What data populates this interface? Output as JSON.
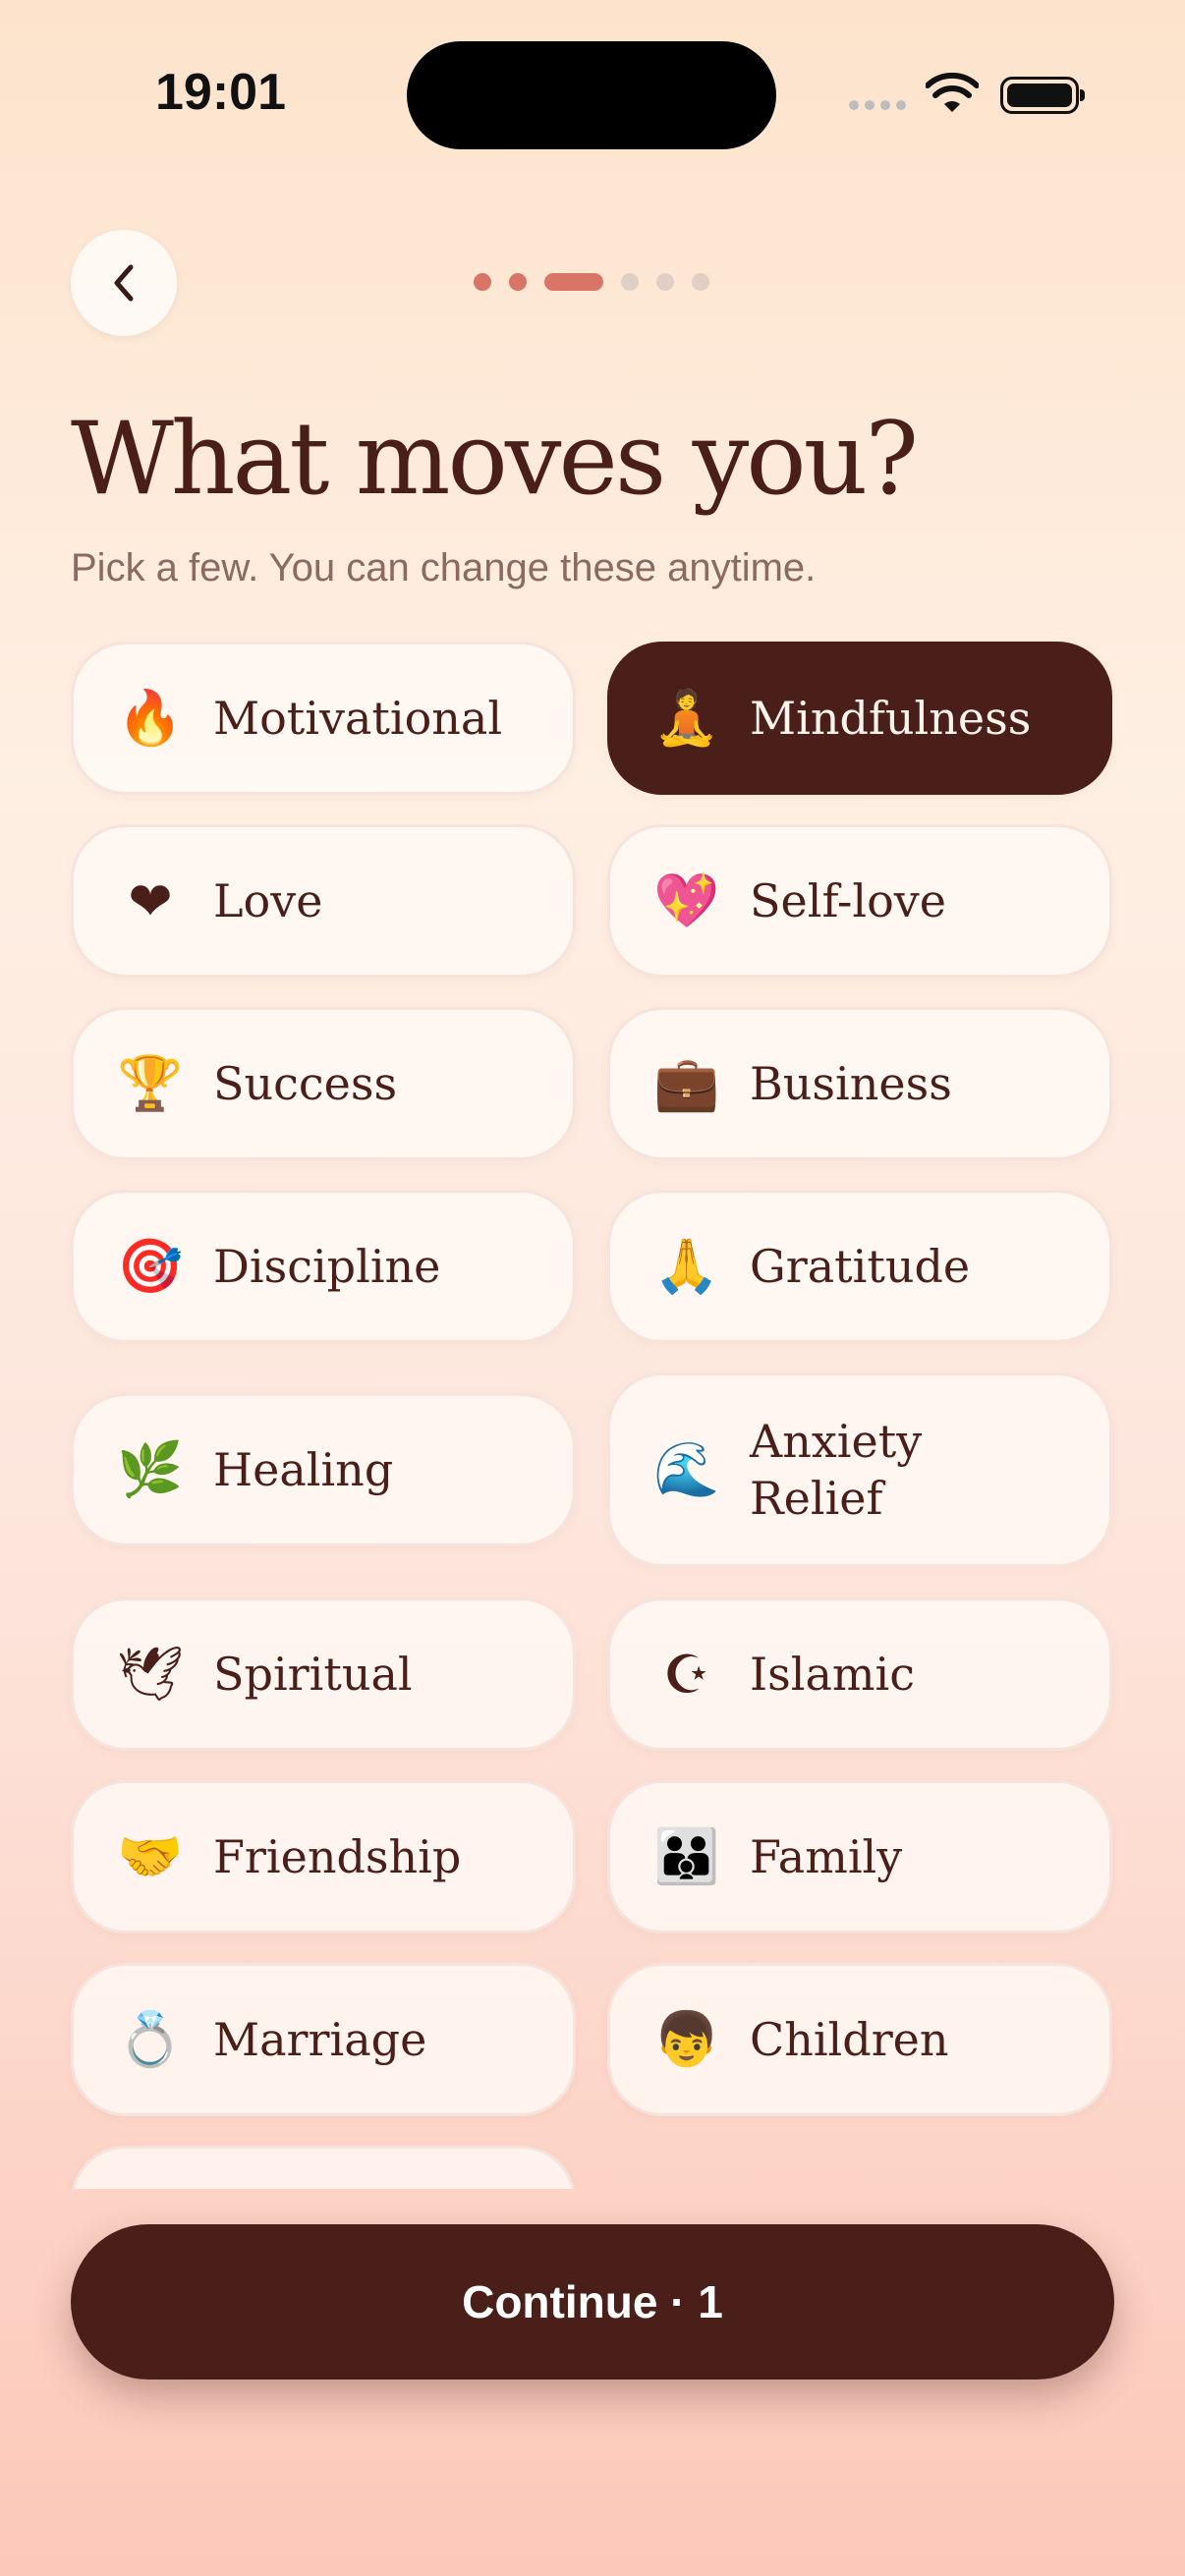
{
  "status_bar": {
    "time": "19:01"
  },
  "header": {
    "progress": {
      "total_steps": 6,
      "current_step": 3
    },
    "title": "What moves you?",
    "subtitle": "Pick a few. You can change these anytime."
  },
  "topics": [
    {
      "label": "Motivational",
      "icon": "fire-icon",
      "glyph": "🔥",
      "selected": false
    },
    {
      "label": "Mindfulness",
      "icon": "meditation-icon",
      "glyph": "🧘",
      "selected": true
    },
    {
      "label": "Love",
      "icon": "heart-icon",
      "glyph": "❤",
      "selected": false
    },
    {
      "label": "Self-love",
      "icon": "sparkling-heart-icon",
      "glyph": "💖",
      "selected": false
    },
    {
      "label": "Success",
      "icon": "trophy-icon",
      "glyph": "🏆",
      "selected": false
    },
    {
      "label": "Business",
      "icon": "briefcase-icon",
      "glyph": "💼",
      "selected": false
    },
    {
      "label": "Discipline",
      "icon": "target-icon",
      "glyph": "🎯",
      "selected": false
    },
    {
      "label": "Gratitude",
      "icon": "praying-hands-icon",
      "glyph": "🙏",
      "selected": false
    },
    {
      "label": "Healing",
      "icon": "herb-icon",
      "glyph": "🌿",
      "selected": false
    },
    {
      "label": "Anxiety Relief",
      "icon": "wave-icon",
      "glyph": "🌊",
      "selected": false
    },
    {
      "label": "Spiritual",
      "icon": "dove-icon",
      "glyph": "🕊",
      "selected": false
    },
    {
      "label": "Islamic",
      "icon": "star-and-crescent-icon",
      "glyph": "☪",
      "selected": false
    },
    {
      "label": "Friendship",
      "icon": "handshake-icon",
      "glyph": "🤝",
      "selected": false
    },
    {
      "label": "Family",
      "icon": "family-icon",
      "glyph": "👪",
      "selected": false
    },
    {
      "label": "Marriage",
      "icon": "ring-icon",
      "glyph": "💍",
      "selected": false
    },
    {
      "label": "Children",
      "icon": "child-icon",
      "glyph": "👦",
      "selected": false
    }
  ],
  "cta": {
    "label": "Continue · 1"
  },
  "colors": {
    "accent": "#4a1f1a",
    "progress": "#d97566"
  }
}
